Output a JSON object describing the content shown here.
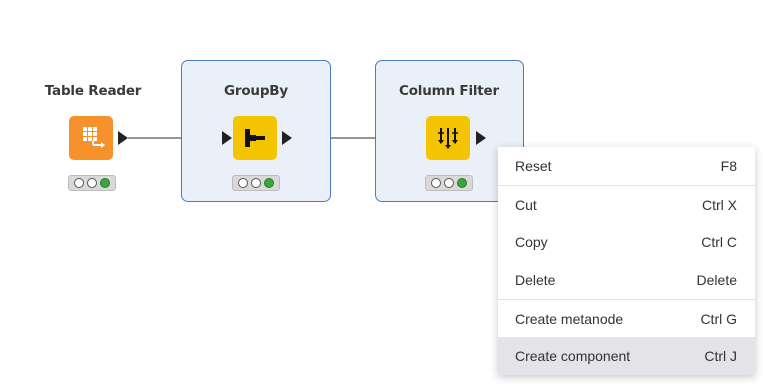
{
  "nodes": [
    {
      "label": "Table Reader",
      "icon": "table-reader-icon",
      "color": "#f7912c",
      "selected": false,
      "status": [
        "off",
        "off",
        "on"
      ]
    },
    {
      "label": "GroupBy",
      "icon": "groupby-icon",
      "color": "#f5c400",
      "selected": true,
      "status": [
        "off",
        "off",
        "on"
      ]
    },
    {
      "label": "Column Filter",
      "icon": "column-filter-icon",
      "color": "#f5c400",
      "selected": true,
      "status": [
        "off",
        "off",
        "on"
      ]
    }
  ],
  "context_menu": {
    "items": [
      {
        "label": "Reset",
        "shortcut": "F8"
      },
      {
        "label": "Cut",
        "shortcut": "Ctrl X"
      },
      {
        "label": "Copy",
        "shortcut": "Ctrl C"
      },
      {
        "label": "Delete",
        "shortcut": "Delete"
      },
      {
        "label": "Create metanode",
        "shortcut": "Ctrl G"
      },
      {
        "label": "Create component",
        "shortcut": "Ctrl J"
      }
    ],
    "hovered_item": "Create component"
  },
  "colors": {
    "selection_border": "#4a7cc0",
    "selection_fill": "#eaf0f8",
    "status_green": "#3aa53a"
  }
}
